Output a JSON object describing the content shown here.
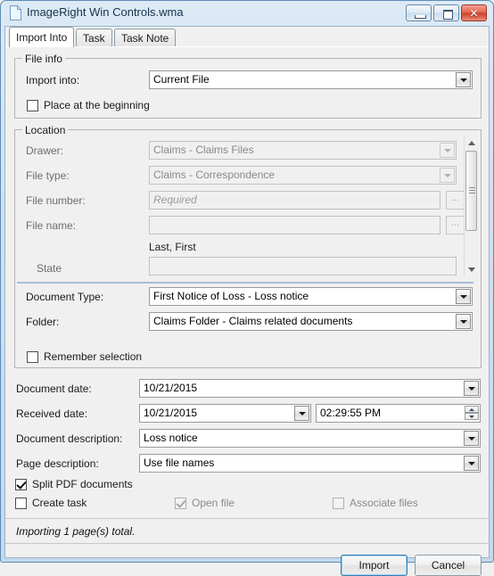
{
  "window": {
    "title": "ImageRight Win Controls.wma",
    "icon": "document-icon",
    "minimize_label": "Minimize",
    "maximize_label": "Maximize",
    "close_label": "Close"
  },
  "tabs": [
    {
      "label": "Import Into",
      "active": true
    },
    {
      "label": "Task",
      "active": false
    },
    {
      "label": "Task Note",
      "active": false
    }
  ],
  "file_info": {
    "group_title": "File info",
    "import_into_label": "Import into:",
    "import_into_value": "Current File",
    "place_at_beginning_label": "Place at the beginning",
    "place_at_beginning_checked": false
  },
  "location": {
    "group_title": "Location",
    "drawer_label": "Drawer:",
    "drawer_value": "Claims - Claims Files",
    "file_type_label": "File type:",
    "file_type_value": "Claims - Correspondence",
    "file_number_label": "File number:",
    "file_number_placeholder": "Required",
    "file_number_value": "",
    "file_name_label": "File name:",
    "file_name_value": "",
    "name_format_hint": "Last, First",
    "state_label": "State",
    "state_value": "",
    "ellipsis_label": "...",
    "document_type_label": "Document Type:",
    "document_type_value": "First Notice of Loss - Loss notice",
    "folder_label": "Folder:",
    "folder_value": "Claims Folder - Claims related documents",
    "remember_selection_label": "Remember selection",
    "remember_selection_checked": false
  },
  "details": {
    "document_date_label": "Document date:",
    "document_date_value": "10/21/2015",
    "received_date_label": "Received date:",
    "received_date_value": "10/21/2015",
    "received_time_value": "02:29:55 PM",
    "document_description_label": "Document description:",
    "document_description_value": "Loss notice",
    "page_description_label": "Page description:",
    "page_description_value": "Use file names"
  },
  "options": {
    "split_pdf_label": "Split PDF documents",
    "split_pdf_checked": true,
    "create_task_label": "Create task",
    "create_task_checked": false,
    "open_file_label": "Open file",
    "open_file_checked": true,
    "associate_files_label": "Associate files",
    "associate_files_checked": false
  },
  "status": {
    "text": "Importing 1 page(s) total."
  },
  "footer": {
    "import_label": "Import",
    "cancel_label": "Cancel"
  },
  "colors": {
    "window_frame": "#5d8cb5",
    "accent_focus": "#3c7fb1",
    "close_button": "#cf3f28",
    "separator": "#a9bdd6"
  }
}
